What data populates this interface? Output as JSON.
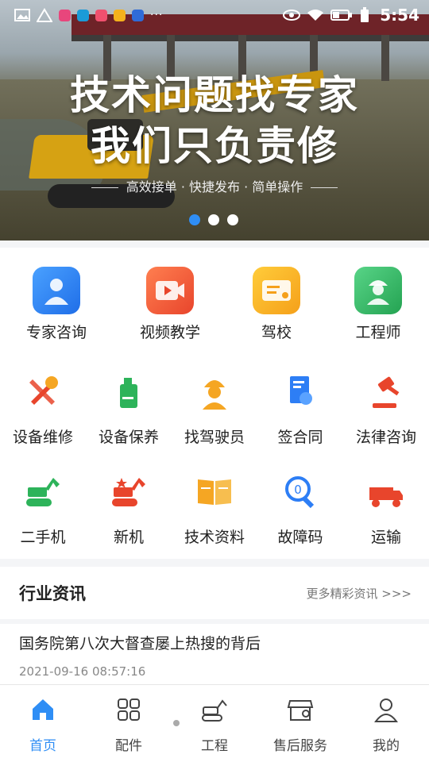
{
  "status_bar": {
    "time": "5:54",
    "more": "···",
    "battery_icon": "battery-icon",
    "wifi_icon": "wifi-icon",
    "eye_icon": "eye-icon"
  },
  "banner": {
    "title_line1": "技术问题找专家",
    "title_line2": "我们只负责修",
    "subtitle": "高效接单 · 快捷发布 · 简单操作",
    "active_slide": 1,
    "slide_count": 3
  },
  "top_services": [
    {
      "label": "专家咨询",
      "icon": "expert-icon",
      "color": "#2d7ef5"
    },
    {
      "label": "视频教学",
      "icon": "video-icon",
      "color": "#f05a34"
    },
    {
      "label": "驾校",
      "icon": "driving-school-icon",
      "color": "#f7a81b"
    },
    {
      "label": "工程师",
      "icon": "engineer-icon",
      "color": "#36b266"
    }
  ],
  "services_row1": [
    {
      "label": "设备维修",
      "icon": "wrench-icon"
    },
    {
      "label": "设备保养",
      "icon": "oil-can-icon"
    },
    {
      "label": "找驾驶员",
      "icon": "driver-icon"
    },
    {
      "label": "签合同",
      "icon": "contract-icon"
    },
    {
      "label": "法律咨询",
      "icon": "gavel-icon"
    }
  ],
  "services_row2": [
    {
      "label": "二手机",
      "icon": "used-machine-icon"
    },
    {
      "label": "新机",
      "icon": "new-machine-icon"
    },
    {
      "label": "技术资料",
      "icon": "book-icon"
    },
    {
      "label": "故障码",
      "icon": "error-code-icon"
    },
    {
      "label": "运输",
      "icon": "truck-icon"
    }
  ],
  "news": {
    "section_title": "行业资讯",
    "more_label": "更多精彩资讯 >>>",
    "items": [
      {
        "title": "国务院第八次大督查屡上热搜的背后",
        "time": "2021-09-16 08:57:16"
      }
    ]
  },
  "bottom_nav": [
    {
      "label": "首页",
      "icon": "home-icon",
      "active": true
    },
    {
      "label": "配件",
      "icon": "grid-icon",
      "active": false
    },
    {
      "label": "工程",
      "icon": "excavator-icon",
      "active": false
    },
    {
      "label": "售后服务",
      "icon": "service-store-icon",
      "active": false
    },
    {
      "label": "我的",
      "icon": "user-icon",
      "active": false
    }
  ],
  "colors": {
    "accent": "#2f8ef5",
    "tool_red": "#e8452c",
    "tool_green": "#2db35a",
    "tool_orange": "#f5a623",
    "tool_blue": "#2d7ef5"
  }
}
